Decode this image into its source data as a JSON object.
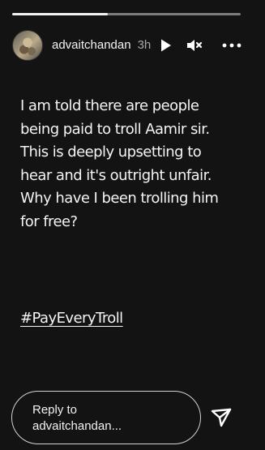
{
  "story": {
    "progress_fraction": 0.42,
    "username": "advaitchandan",
    "timestamp": "3h",
    "text": "I am told there are people\nbeing paid to troll Aamir sir.\nThis is deeply upsetting to\nhear and it's outright unfair.\nWhy have I been trolling him\nfor free?",
    "hashtag": "#PayEveryTroll"
  },
  "reply": {
    "placeholder": "Reply to\nadvaitchandan..."
  },
  "icons": {
    "play": "play-icon",
    "mute": "speaker-muted-icon",
    "more": "more-options-icon",
    "send": "send-icon"
  },
  "colors": {
    "background": "#131313",
    "text": "#f4f4f4",
    "muted_text": "#a7a7a7",
    "progress_fill": "#f2f2f2"
  }
}
